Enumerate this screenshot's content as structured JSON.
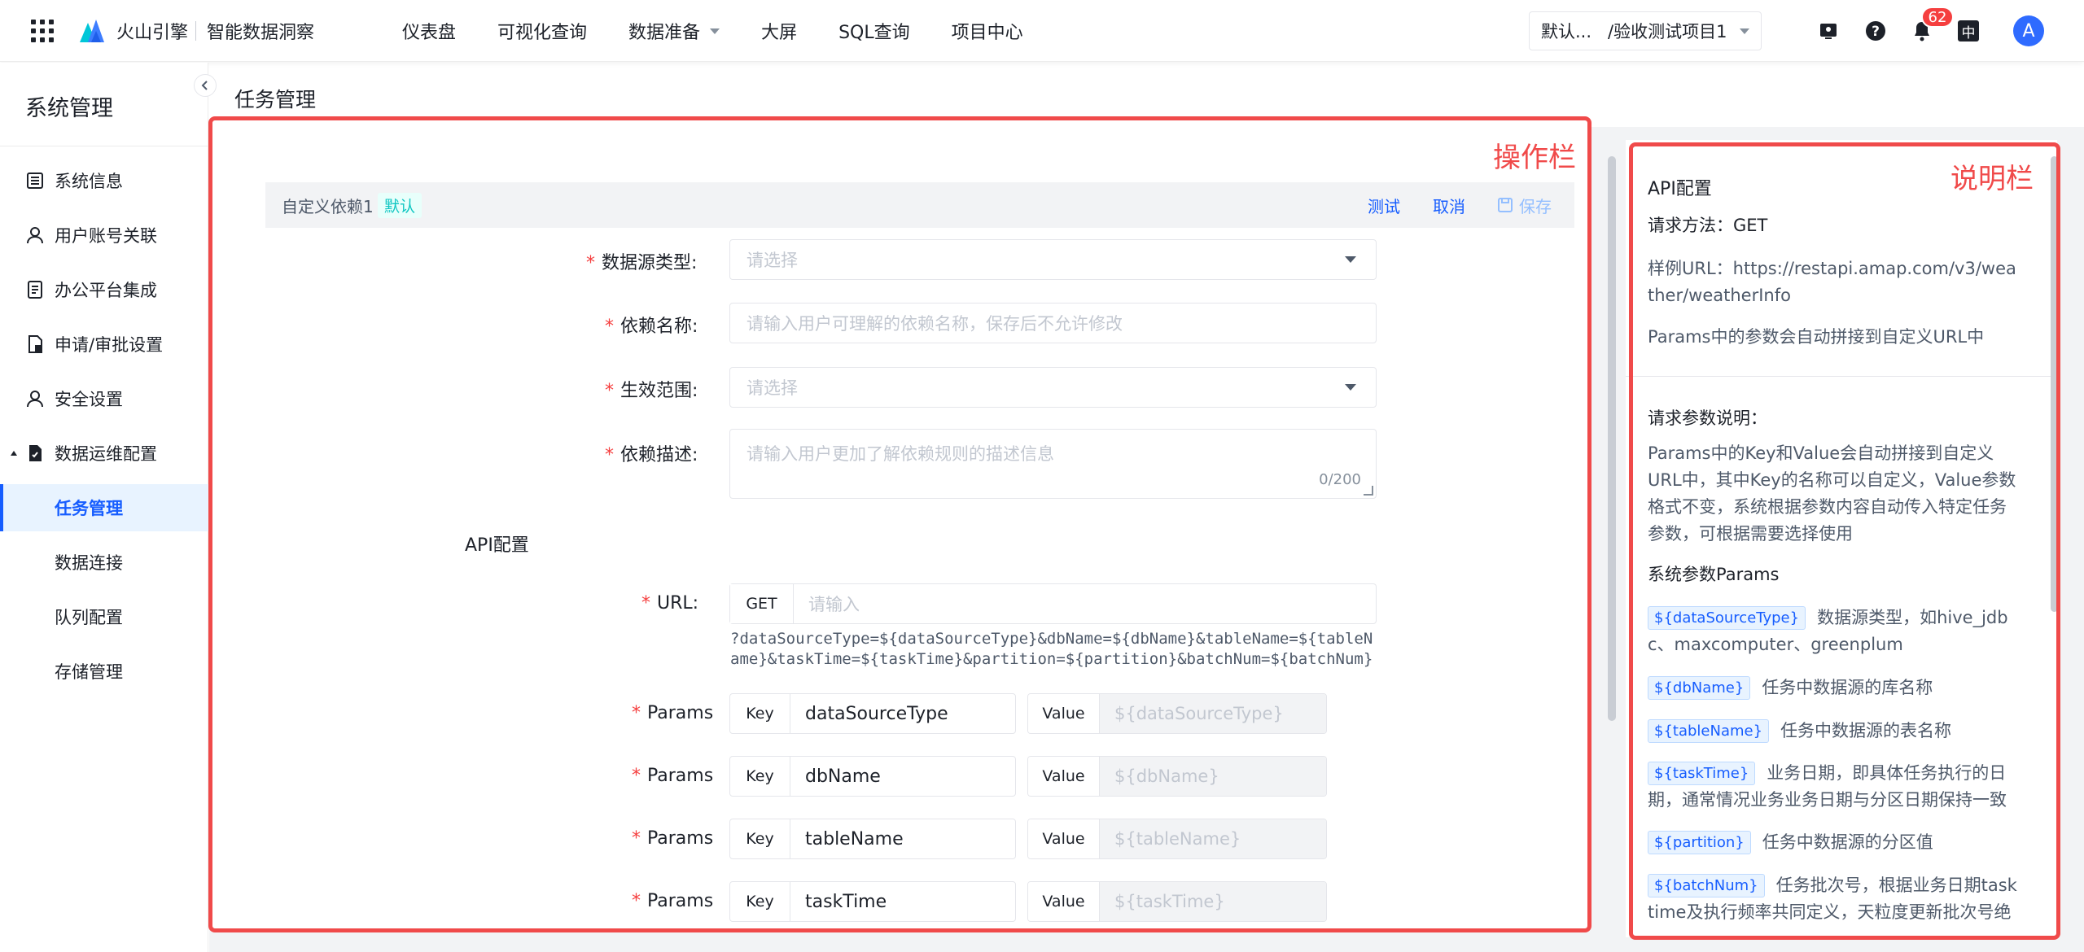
{
  "topbar": {
    "brand": "火山引擎",
    "product": "智能数据洞察",
    "nav": [
      {
        "label": "仪表盘",
        "dropdown": false
      },
      {
        "label": "可视化查询",
        "dropdown": false
      },
      {
        "label": "数据准备",
        "dropdown": true
      },
      {
        "label": "大屏",
        "dropdown": false
      },
      {
        "label": "SQL查询",
        "dropdown": false
      },
      {
        "label": "项目中心",
        "dropdown": false
      }
    ],
    "project_selector": "默认...   /验收测试项目1",
    "notification_count": "62",
    "lang": "中",
    "avatar_initial": "A"
  },
  "sidebar": {
    "title": "系统管理",
    "items": [
      {
        "label": "系统信息",
        "icon": "list-icon"
      },
      {
        "label": "用户账号关联",
        "icon": "user-icon"
      },
      {
        "label": "办公平台集成",
        "icon": "document-icon"
      },
      {
        "label": "申请/审批设置",
        "icon": "file-check-icon"
      },
      {
        "label": "安全设置",
        "icon": "user-shield-icon"
      },
      {
        "label": "数据运维配置",
        "icon": "file-settings-icon",
        "expanded": true
      },
      {
        "label": "任务管理",
        "active": true
      },
      {
        "label": "数据连接"
      },
      {
        "label": "队列配置"
      },
      {
        "label": "存储管理"
      }
    ]
  },
  "page": {
    "title": "任务管理"
  },
  "annotations": {
    "operation": "操作栏",
    "description": "说明栏"
  },
  "dependency": {
    "name": "自定义依赖1",
    "tag": "默认",
    "actions": {
      "test": "测试",
      "cancel": "取消",
      "save": "保存"
    }
  },
  "form": {
    "datasource_type": {
      "label": "数据源类型:",
      "placeholder": "请选择"
    },
    "dep_name": {
      "label": "依赖名称:",
      "placeholder": "请输入用户可理解的依赖名称，保存后不允许修改"
    },
    "scope": {
      "label": "生效范围:",
      "placeholder": "请选择"
    },
    "description": {
      "label": "依赖描述:",
      "placeholder": "请输入用户更加了解依赖规则的描述信息",
      "counter": "0/200"
    },
    "api_section": "API配置",
    "url": {
      "label": "URL:",
      "method": "GET",
      "placeholder": "请输入",
      "hint": "?dataSourceType=${dataSourceType}&dbName=${dbName}&tableName=${tableName}&taskTime=${taskTime}&partition=${partition}&batchNum=${batchNum}"
    },
    "params_label": "Params",
    "key_label": "Key",
    "value_label": "Value",
    "params": [
      {
        "key": "dataSourceType",
        "value": "${dataSourceType}"
      },
      {
        "key": "dbName",
        "value": "${dbName}"
      },
      {
        "key": "tableName",
        "value": "${tableName}"
      },
      {
        "key": "taskTime",
        "value": "${taskTime}"
      }
    ]
  },
  "help": {
    "title": "API配置",
    "method": "请求方法：GET",
    "sample_url": "样例URL：https://restapi.amap.com/v3/weather/weatherInfo",
    "params_note": "Params中的参数会自动拼接到自定义URL中",
    "req_title": "请求参数说明：",
    "req_desc": "Params中的Key和Value会自动拼接到自定义URL中，其中Key的名称可以自定义，Value参数格式不变，系统根据参数内容自动传入特定任务参数，可根据需要选择使用",
    "sys_params_title": "系统参数Params",
    "sys_params": [
      {
        "tag": "${dataSourceType}",
        "desc": "数据源类型，如hive_jdbc、maxcomputer、greenplum"
      },
      {
        "tag": "${dbName}",
        "desc": "任务中数据源的库名称"
      },
      {
        "tag": "${tableName}",
        "desc": "任务中数据源的表名称"
      },
      {
        "tag": "${taskTime}",
        "desc": "业务日期，即具体任务执行的日期，通常情况业务业务日期与分区日期保持一致"
      },
      {
        "tag": "${partition}",
        "desc": "任务中数据源的分区值"
      },
      {
        "tag": "${batchNum}",
        "desc": "任务批次号，根据业务日期tasktime及执行频率共同定义，天粒度更新批次号绝对"
      }
    ]
  }
}
